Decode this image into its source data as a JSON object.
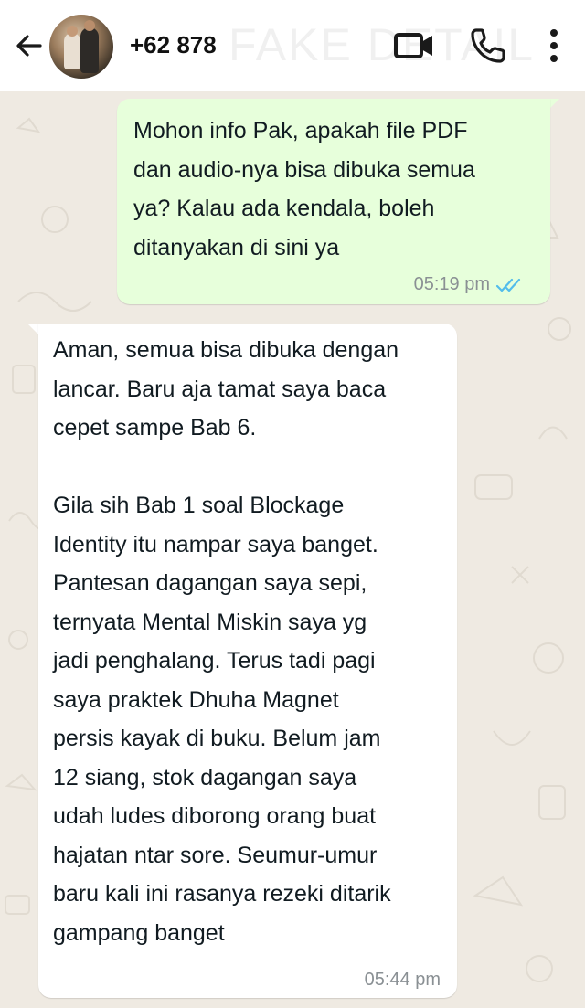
{
  "header": {
    "contact_name": "+62 878",
    "watermark": "FAKE DETAIL",
    "icons": [
      "back-arrow-icon",
      "avatar",
      "video-call-icon",
      "voice-call-icon",
      "more-options-icon"
    ]
  },
  "messages": [
    {
      "direction": "outgoing",
      "text": "Mohon info Pak, apakah file PDF\ndan audio-nya bisa dibuka semua\nya? Kalau ada kendala, boleh\nditanyakan di sini ya",
      "time": "05:19 pm",
      "status": "read",
      "status_color": "#53bdeb"
    },
    {
      "direction": "incoming",
      "text": "Aman, semua bisa dibuka dengan\nlancar. Baru aja tamat saya baca\ncepet sampe Bab 6.\n\nGila sih Bab 1 soal Blockage\nIdentity itu nampar saya banget.\nPantesan dagangan saya sepi,\nternyata Mental Miskin saya yg\njadi penghalang. Terus tadi pagi\nsaya praktek Dhuha Magnet\npersis kayak di buku. Belum jam\n12 siang, stok dagangan saya\nudah ludes diborong orang buat\nhajatan ntar sore. Seumur-umur\nbaru kali ini rasanya rezeki ditarik\ngampang banget",
      "time": "05:44 pm"
    }
  ],
  "colors": {
    "chat_background": "#efeae2",
    "outgoing_bubble": "#e7ffdb",
    "incoming_bubble": "#ffffff",
    "timestamp": "#8a9094"
  }
}
